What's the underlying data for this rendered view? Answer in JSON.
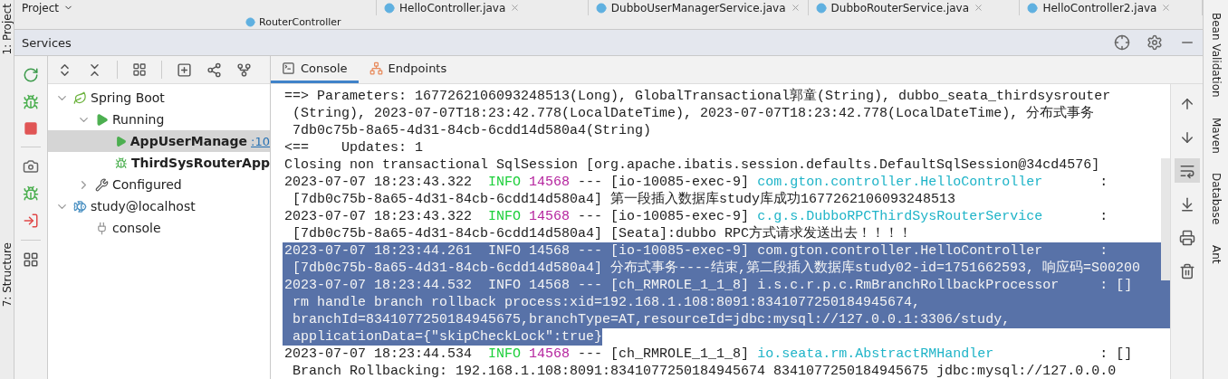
{
  "editor_tabs": [
    {
      "label": "Project",
      "kind": "dropdown"
    },
    {
      "label": "HelloController.java",
      "kind": "file"
    },
    {
      "label": "DubboUserManagerService.java",
      "kind": "file"
    },
    {
      "label": "DubboRouterService.java",
      "kind": "file"
    },
    {
      "label": "HelloController2.java",
      "kind": "file"
    }
  ],
  "breadcrumb": "RouterController",
  "left_strip": [
    "1: Project",
    "7: Structure"
  ],
  "right_strip": [
    "Bean Validation",
    "Maven",
    "Database",
    "Ant"
  ],
  "services": {
    "title": "Services",
    "tree": [
      {
        "label": "Spring Boot",
        "kind": "spring",
        "expanded": true,
        "selected": false,
        "children": [
          {
            "label": "Running",
            "kind": "running",
            "expanded": true,
            "selected": false,
            "children": [
              {
                "label": "AppUserManage",
                "kind": "app",
                "selected": true,
                "port": ":10"
              },
              {
                "label": "ThirdSysRouterApp",
                "kind": "debug-app",
                "selected": false
              }
            ]
          },
          {
            "label": "Configured",
            "kind": "config",
            "expanded": false,
            "selected": false
          }
        ]
      },
      {
        "label": "study@localhost",
        "kind": "database",
        "expanded": true,
        "selected": false,
        "children": [
          {
            "label": "console",
            "kind": "console",
            "selected": false
          }
        ]
      }
    ],
    "console_tabs": [
      {
        "label": "Console",
        "kind": "console",
        "selected": true
      },
      {
        "label": "Endpoints",
        "kind": "endpoints",
        "selected": false
      }
    ],
    "console_tools": [
      {
        "kind": "up",
        "selected": false
      },
      {
        "kind": "down",
        "selected": false
      },
      {
        "kind": "wrap",
        "selected": true
      },
      {
        "kind": "scroll-end",
        "selected": false
      },
      {
        "kind": "print",
        "selected": false
      },
      {
        "kind": "clear",
        "selected": false
      }
    ],
    "console_lines": [
      {
        "selected": false,
        "segments": [
          {
            "kind": "text",
            "text": "==> Parameters: 1677262106093248513(Long), GlobalTransactional郭童(String), dubbo_seata_thirdsysrouter"
          }
        ]
      },
      {
        "selected": false,
        "segments": [
          {
            "kind": "text",
            "text": " (String), 2023-07-07T18:23:42.778(LocalDateTime), 2023-07-07T18:23:42.778(LocalDateTime), 分布式事务"
          }
        ]
      },
      {
        "selected": false,
        "segments": [
          {
            "kind": "text",
            "text": " 7db0c75b-8a65-4d31-84cb-6cdd14d580a4(String)"
          }
        ]
      },
      {
        "selected": false,
        "segments": [
          {
            "kind": "text",
            "text": "<==    Updates: 1"
          }
        ]
      },
      {
        "selected": false,
        "segments": [
          {
            "kind": "text",
            "text": "Closing non transactional SqlSession [org.apache.ibatis.session.defaults.DefaultSqlSession@34cd4576]"
          }
        ]
      },
      {
        "selected": false,
        "segments": [
          {
            "kind": "text",
            "text": "2023-07-07 18:23:43.322  "
          },
          {
            "kind": "level",
            "text": "INFO "
          },
          {
            "kind": "pid",
            "text": "14568"
          },
          {
            "kind": "text",
            "text": " --- [io-10085-exec-9] "
          },
          {
            "kind": "logger",
            "text": "com.gton.controller.HelloController"
          },
          {
            "kind": "text",
            "text": "       :"
          }
        ]
      },
      {
        "selected": false,
        "segments": [
          {
            "kind": "text",
            "text": " [7db0c75b-8a65-4d31-84cb-6cdd14d580a4] 第一段插入数据库study库成功1677262106093248513"
          }
        ]
      },
      {
        "selected": false,
        "segments": [
          {
            "kind": "text",
            "text": "2023-07-07 18:23:43.322  "
          },
          {
            "kind": "level",
            "text": "INFO "
          },
          {
            "kind": "pid",
            "text": "14568"
          },
          {
            "kind": "text",
            "text": " --- [io-10085-exec-9] "
          },
          {
            "kind": "logger",
            "text": "c.g.s.DubboRPCThirdSysRouterService"
          },
          {
            "kind": "text",
            "text": "       :"
          }
        ]
      },
      {
        "selected": false,
        "segments": [
          {
            "kind": "text",
            "text": " [7db0c75b-8a65-4d31-84cb-6cdd14d580a4] [Seata]:dubbo RPC方式请求发送出去！！！！"
          }
        ]
      },
      {
        "selected": true,
        "segments": [
          {
            "kind": "text",
            "text": "2023-07-07 18:23:44.261  "
          },
          {
            "kind": "level",
            "text": "INFO "
          },
          {
            "kind": "pid",
            "text": "14568"
          },
          {
            "kind": "text",
            "text": " --- [io-10085-exec-9] "
          },
          {
            "kind": "logger",
            "text": "com.gton.controller.HelloController"
          },
          {
            "kind": "text",
            "text": "       :"
          }
        ]
      },
      {
        "selected": true,
        "segments": [
          {
            "kind": "text",
            "text": " [7db0c75b-8a65-4d31-84cb-6cdd14d580a4] 分布式事务----结束,第二段插入数据库study02-id=1751662593, 响应码=S00200"
          }
        ]
      },
      {
        "selected": true,
        "segments": [
          {
            "kind": "text",
            "text": "2023-07-07 18:23:44.532  "
          },
          {
            "kind": "level",
            "text": "INFO "
          },
          {
            "kind": "pid",
            "text": "14568"
          },
          {
            "kind": "text",
            "text": " --- [ch_RMROLE_1_1_8] "
          },
          {
            "kind": "logger",
            "text": "i.s.c.r.p.c.RmBranchRollbackProcessor"
          },
          {
            "kind": "text",
            "text": "     : []"
          }
        ]
      },
      {
        "selected": true,
        "segments": [
          {
            "kind": "text",
            "text": " rm handle branch rollback process:xid=192.168.1.108:8091:8341077250184945674,"
          }
        ]
      },
      {
        "selected": true,
        "segments": [
          {
            "kind": "text",
            "text": " branchId=8341077250184945675,branchType=AT,resourceId=jdbc:mysql://127.0.0.1:3306/study,"
          }
        ]
      },
      {
        "selected": true,
        "segments": [
          {
            "kind": "text",
            "text": " applicationData={\"skipCheckLock\":true}"
          }
        ]
      },
      {
        "selected": false,
        "segments": [
          {
            "kind": "text",
            "text": "2023-07-07 18:23:44.534  "
          },
          {
            "kind": "level",
            "text": "INFO "
          },
          {
            "kind": "pid",
            "text": "14568"
          },
          {
            "kind": "text",
            "text": " --- [ch_RMROLE_1_1_8] "
          },
          {
            "kind": "logger",
            "text": "io.seata.rm.AbstractRMHandler"
          },
          {
            "kind": "text",
            "text": "             : []"
          }
        ]
      },
      {
        "selected": false,
        "segments": [
          {
            "kind": "text",
            "text": " Branch Rollbacking: 192.168.1.108:8091:8341077250184945674 8341077250184945675 jdbc:mysql://127.0.0.0"
          }
        ]
      }
    ]
  }
}
